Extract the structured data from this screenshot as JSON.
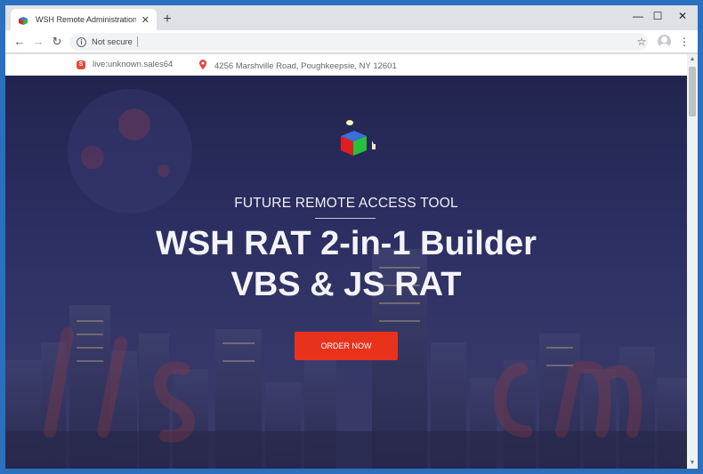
{
  "browser": {
    "tab_title": "WSH Remote Administration Too",
    "tab_close": "✕",
    "new_tab": "+",
    "minimize": "—",
    "maximize": "☐",
    "close": "✕",
    "back": "←",
    "forward": "→",
    "reload": "↻",
    "security_label": "Not secure",
    "star": "☆",
    "menu": "⋮"
  },
  "topbar": {
    "skype_handle": "live:unknown.sales64",
    "address": "4256 Marshville Road, Poughkeepsie, NY 12601"
  },
  "hero": {
    "subtitle": "FUTURE REMOTE ACCESS TOOL",
    "headline_line1": "WSH RAT 2-in-1 Builder",
    "headline_line2": "VBS & JS RAT",
    "cta_label": "ORDER NOW"
  },
  "colors": {
    "cta": "#e8321c",
    "window_border": "#2b6fbf",
    "hero_bg": "#2c2f62"
  }
}
